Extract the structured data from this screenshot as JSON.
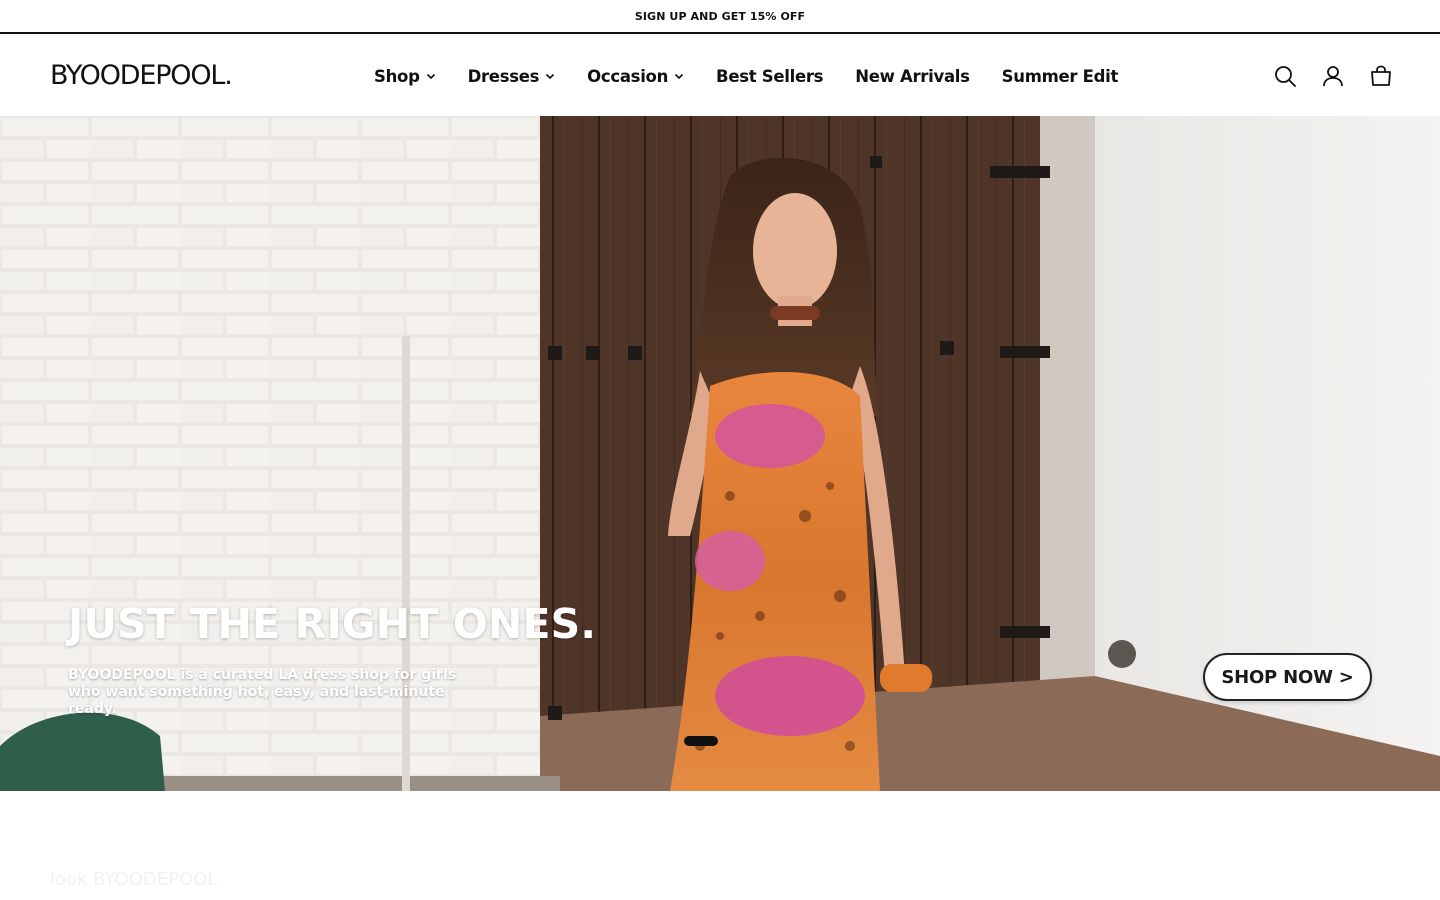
{
  "announcement": {
    "text": "SIGN UP AND GET 15% OFF"
  },
  "header": {
    "logo": "BYOODEPOOL.",
    "nav": [
      {
        "label": "Shop",
        "has_dropdown": true
      },
      {
        "label": "Dresses",
        "has_dropdown": true
      },
      {
        "label": "Occasion",
        "has_dropdown": true
      },
      {
        "label": "Best Sellers",
        "has_dropdown": false
      },
      {
        "label": "New Arrivals",
        "has_dropdown": false
      },
      {
        "label": "Summer Edit",
        "has_dropdown": false
      }
    ],
    "icons": [
      "search-icon",
      "account-icon",
      "cart-icon"
    ]
  },
  "hero": {
    "title": "JUST THE RIGHT ONES.",
    "subtitle": "BYOODEPOOL is a curated LA dress shop for girls who want something hot, easy, and last-minute ready.",
    "cta_label": "SHOP NOW >",
    "slide_count": 1,
    "active_slide": 1
  },
  "section": {
    "heading": "look BYOODEPOOL"
  },
  "colors": {
    "text": "#111111",
    "background": "#ffffff",
    "door": "#4a3326",
    "dress_orange": "#e0823a",
    "dress_pink": "#d8579b"
  }
}
